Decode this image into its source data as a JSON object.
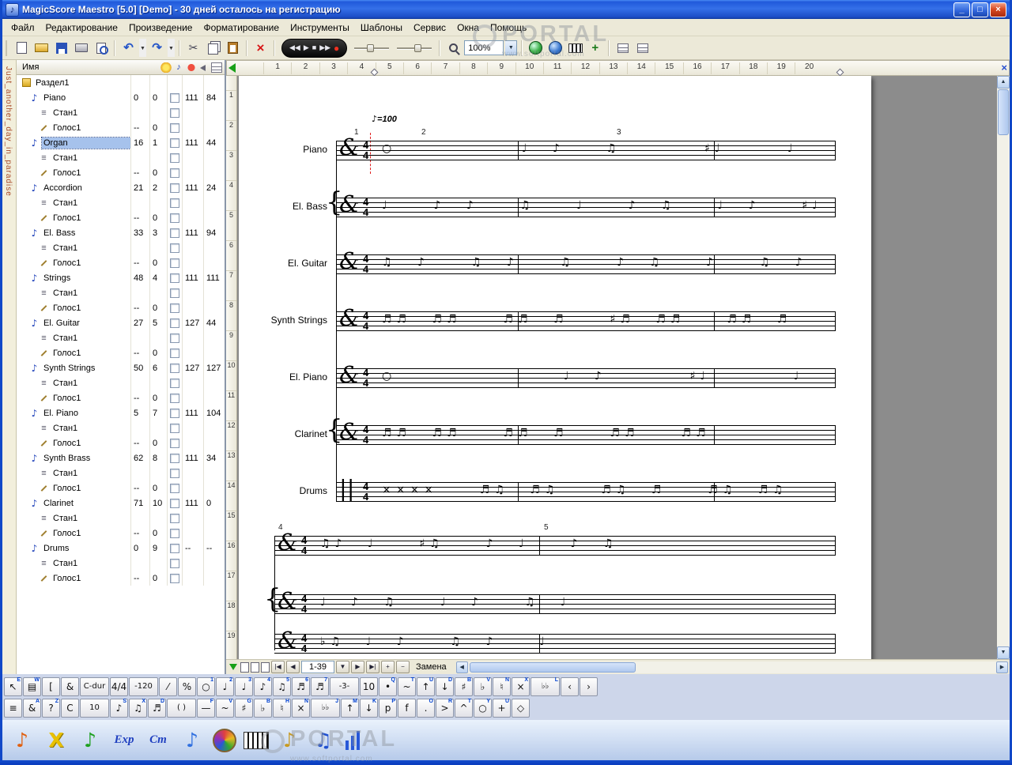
{
  "window": {
    "title": "MagicScore Maestro [5.0] [Demo] - 30 дней осталось на регистрацию",
    "icon": "♪",
    "min": "_",
    "max": "□",
    "close": "×",
    "doc_tab": "Just_another_day_in_paradise"
  },
  "watermark": {
    "brand": "PORTAL",
    "url": "www.softportal.com"
  },
  "menu": {
    "items": [
      "Файл",
      "Редактирование",
      "Произведение",
      "Форматирование",
      "Инструменты",
      "Шаблоны",
      "Сервис",
      "Окна",
      "Помощь"
    ]
  },
  "toolbar": {
    "zoom": "100%",
    "playback": [
      {
        "g": "◀◀",
        "c": "w"
      },
      {
        "g": "▶",
        "c": "w"
      },
      {
        "g": "■",
        "c": "w"
      },
      {
        "g": "▶▶",
        "c": "w"
      },
      {
        "g": "●",
        "c": "red"
      }
    ]
  },
  "tracks": {
    "header": "Имя",
    "rows": [
      {
        "t": "sec",
        "n": "Раздел1",
        "nb": 1
      },
      {
        "t": "ins",
        "n": "Piano",
        "a": "0",
        "b": "0",
        "c": "111",
        "d": "84"
      },
      {
        "t": "staff",
        "n": "Стан1"
      },
      {
        "t": "voice",
        "n": "Голос1",
        "a": "--",
        "b": "0"
      },
      {
        "t": "ins",
        "n": "Organ",
        "a": "16",
        "b": "1",
        "c": "111",
        "d": "44",
        "sel": 1
      },
      {
        "t": "staff",
        "n": "Стан1"
      },
      {
        "t": "voice",
        "n": "Голос1",
        "a": "--",
        "b": "0"
      },
      {
        "t": "ins",
        "n": "Accordion",
        "a": "21",
        "b": "2",
        "c": "111",
        "d": "24"
      },
      {
        "t": "staff",
        "n": "Стан1"
      },
      {
        "t": "voice",
        "n": "Голос1",
        "a": "--",
        "b": "0"
      },
      {
        "t": "ins",
        "n": "El. Bass",
        "a": "33",
        "b": "3",
        "c": "111",
        "d": "94"
      },
      {
        "t": "staff",
        "n": "Стан1"
      },
      {
        "t": "voice",
        "n": "Голос1",
        "a": "--",
        "b": "0"
      },
      {
        "t": "ins",
        "n": "Strings",
        "a": "48",
        "b": "4",
        "c": "111",
        "d": "111"
      },
      {
        "t": "staff",
        "n": "Стан1"
      },
      {
        "t": "voice",
        "n": "Голос1",
        "a": "--",
        "b": "0"
      },
      {
        "t": "ins",
        "n": "El. Guitar",
        "a": "27",
        "b": "5",
        "c": "127",
        "d": "44"
      },
      {
        "t": "staff",
        "n": "Стан1"
      },
      {
        "t": "voice",
        "n": "Голос1",
        "a": "--",
        "b": "0"
      },
      {
        "t": "ins",
        "n": "Synth Strings",
        "a": "50",
        "b": "6",
        "c": "127",
        "d": "127"
      },
      {
        "t": "staff",
        "n": "Стан1"
      },
      {
        "t": "voice",
        "n": "Голос1",
        "a": "--",
        "b": "0"
      },
      {
        "t": "ins",
        "n": "El. Piano",
        "a": "5",
        "b": "7",
        "c": "111",
        "d": "104"
      },
      {
        "t": "staff",
        "n": "Стан1"
      },
      {
        "t": "voice",
        "n": "Голос1",
        "a": "--",
        "b": "0"
      },
      {
        "t": "ins",
        "n": "Synth Brass",
        "a": "62",
        "b": "8",
        "c": "111",
        "d": "34"
      },
      {
        "t": "staff",
        "n": "Стан1"
      },
      {
        "t": "voice",
        "n": "Голос1",
        "a": "--",
        "b": "0"
      },
      {
        "t": "ins",
        "n": "Clarinet",
        "a": "71",
        "b": "10",
        "c": "111",
        "d": "0"
      },
      {
        "t": "staff",
        "n": "Стан1"
      },
      {
        "t": "voice",
        "n": "Голос1",
        "a": "--",
        "b": "0"
      },
      {
        "t": "ins",
        "n": "Drums",
        "a": "0",
        "b": "9",
        "c": "--",
        "d": "--"
      },
      {
        "t": "staff",
        "n": "Стан1"
      },
      {
        "t": "voice",
        "n": "Голос1",
        "a": "--",
        "b": "0"
      }
    ]
  },
  "score": {
    "hruler": [
      "1",
      "2",
      "3",
      "4",
      "5",
      "6",
      "7",
      "8",
      "9",
      "10",
      "11",
      "12",
      "13",
      "14",
      "15",
      "16",
      "17",
      "18",
      "19",
      "20"
    ],
    "vruler": [
      "1",
      "2",
      "3",
      "4",
      "5",
      "6",
      "7",
      "8",
      "9",
      "10",
      "11",
      "12",
      "13",
      "14",
      "15",
      "16",
      "17",
      "18",
      "19"
    ],
    "tempo": "=100",
    "time_top": "4",
    "time_bot": "4",
    "measures": [
      "1",
      "2",
      "3",
      "4",
      "5"
    ],
    "staves": [
      {
        "label": "Piano",
        "clef": "&",
        "brace": "",
        "notes": "○      ♩ ♪  ♫    ♯♩   ♩   ♪  ♩"
      },
      {
        "label": "El. Bass",
        "clef": "&",
        "brace": "{",
        "notes": "♩  ♪ ♪  ♫  ♩  ♪ ♫  ♩ ♪  ♯♩"
      },
      {
        "label": "El. Guitar",
        "clef": "&",
        "brace": "",
        "notes": "♫ ♪  ♫ ♪  ♫  ♪ ♫  ♪  ♫ ♪"
      },
      {
        "label": "Synth Strings",
        "clef": "&",
        "brace": "",
        "notes": "♬♬ ♬♬  ♬♬ ♬  ♯♬ ♬♬  ♬♬ ♬"
      },
      {
        "label": "El. Piano",
        "clef": "&",
        "brace": "",
        "notes": "○        ♩ ♪    ♯♩    ♩"
      },
      {
        "label": "Clarinet",
        "clef": "&",
        "brace": "{",
        "notes": "♬♬ ♬♬  ♬♬ ♬  ♬♬  ♬♬"
      },
      {
        "label": "Drums",
        "clef": "||",
        "brace": "",
        "notes": "××××  ♬♫ ♬♫  ♬♫ ♬  ♬♫ ♬♫"
      },
      {
        "label": "",
        "clef": "&",
        "brace": "",
        "notes": "♫♪ ♩  ♯♫  ♪ ♩  ♪ ♫"
      },
      {
        "label": "",
        "clef": "&",
        "brace": "{",
        "notes": "♩ ♪ ♫  ♩ ♪  ♫ ♩"
      },
      {
        "label": "",
        "clef": "&",
        "brace": "",
        "notes": "♭♫ ♩ ♪  ♫ ♪  ♩"
      }
    ]
  },
  "nav": {
    "range": "1-39",
    "mode": "Замена"
  },
  "palette": {
    "row1": [
      {
        "g": "↖",
        "k": "E"
      },
      {
        "g": "▤",
        "k": "W"
      },
      {
        "g": "[",
        "k": ""
      },
      {
        "g": "&",
        "k": ""
      },
      {
        "g": "C-dur",
        "k": "",
        "w": 1
      },
      {
        "g": "4/4",
        "k": ""
      },
      {
        "g": "-120",
        "k": "",
        "w": 1
      },
      {
        "g": "⁄",
        "k": ""
      },
      {
        "g": "%",
        "k": ""
      },
      {
        "g": "○",
        "k": "1"
      },
      {
        "g": "♩",
        "k": "2"
      },
      {
        "g": "♩",
        "k": "3"
      },
      {
        "g": "♪",
        "k": "4"
      },
      {
        "g": "♫",
        "k": "5"
      },
      {
        "g": "♬",
        "k": "6"
      },
      {
        "g": "♬",
        "k": "7"
      },
      {
        "g": "-3-",
        "k": "",
        "w": 1
      },
      {
        "g": "10",
        "k": ""
      },
      {
        "g": "•",
        "k": "Q"
      },
      {
        "g": "~",
        "k": "T"
      },
      {
        "g": "↑",
        "k": "U"
      },
      {
        "g": "↓",
        "k": "D"
      },
      {
        "g": "♯",
        "k": "B"
      },
      {
        "g": "♭",
        "k": "V"
      },
      {
        "g": "♮",
        "k": "N"
      },
      {
        "g": "×",
        "k": "X"
      },
      {
        "g": "♭♭",
        "k": "L",
        "w": 1
      },
      {
        "g": "‹",
        "k": ""
      },
      {
        "g": "›",
        "k": ""
      }
    ],
    "row2": [
      {
        "g": "≡",
        "k": ""
      },
      {
        "g": "&",
        "k": "A"
      },
      {
        "g": "?",
        "k": "Z"
      },
      {
        "g": "C",
        "k": ""
      },
      {
        "g": "10",
        "k": "",
        "w": 1
      },
      {
        "g": "♪",
        "k": "S"
      },
      {
        "g": "♫",
        "k": "X"
      },
      {
        "g": "♬",
        "k": "D"
      },
      {
        "g": "( )",
        "k": "",
        "w": 1
      },
      {
        "g": "—",
        "k": "F"
      },
      {
        "g": "~",
        "k": "V"
      },
      {
        "g": "♯",
        "k": "G"
      },
      {
        "g": "♭",
        "k": "B"
      },
      {
        "g": "♮",
        "k": "H"
      },
      {
        "g": "×",
        "k": "N"
      },
      {
        "g": "♭♭",
        "k": "J",
        "w": 1
      },
      {
        "g": "↑",
        "k": "M"
      },
      {
        "g": "↓",
        "k": "K"
      },
      {
        "g": "p",
        "k": "P"
      },
      {
        "g": "f",
        "k": ""
      },
      {
        "g": ".",
        "k": "O"
      },
      {
        "g": ">",
        "k": "R"
      },
      {
        "g": "^",
        "k": "T"
      },
      {
        "g": "○",
        "k": "Y"
      },
      {
        "g": "+",
        "k": "U"
      },
      {
        "g": "◇",
        "k": ""
      }
    ]
  },
  "launcher": {
    "items": [
      {
        "name": "notation-icon",
        "g": "♪",
        "c": "orange"
      },
      {
        "name": "cut-icon",
        "g": "X",
        "c": "yellow"
      },
      {
        "name": "add-note-icon",
        "g": "♪",
        "c": "green"
      },
      {
        "name": "export-icon",
        "g": "Exp",
        "c": "blue"
      },
      {
        "name": "chord-icon",
        "g": "Cm",
        "c": "blue"
      },
      {
        "name": "note-icon",
        "g": "♪",
        "c": "skyblue"
      },
      {
        "name": "palette-icon",
        "g": "",
        "c": "palette"
      },
      {
        "name": "keyboard-icon",
        "g": "",
        "c": "keys"
      },
      {
        "name": "note-gold-icon",
        "g": "♪",
        "c": "gold"
      },
      {
        "name": "notes-icon",
        "g": "♫",
        "c": "blue2"
      },
      {
        "name": "mixer-icon",
        "g": "",
        "c": "bars"
      }
    ]
  }
}
